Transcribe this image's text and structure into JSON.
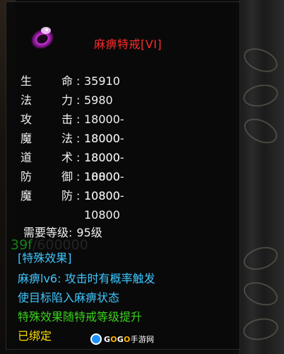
{
  "item": {
    "name": "麻痹特戒[VI]",
    "stats": [
      {
        "k1": "生",
        "k2": "命",
        "value": "35910"
      },
      {
        "k1": "法",
        "k2": "力",
        "value": "5980"
      },
      {
        "k1": "攻",
        "k2": "击",
        "value": "18000-18000"
      },
      {
        "k1": "魔",
        "k2": "法",
        "value": "18000-18000"
      },
      {
        "k1": "道",
        "k2": "术",
        "value": "18000-18000"
      },
      {
        "k1": "防",
        "k2": "御",
        "value": "10800-10800"
      },
      {
        "k1": "魔",
        "k2": "防",
        "value": "10800-10800"
      }
    ],
    "separator": ":",
    "required_level_label": "需要等级:",
    "required_level_value": "95级",
    "progress_current": "39f",
    "progress_slash": "/",
    "progress_total": "600000",
    "effects": {
      "header": "[特殊效果]",
      "line1": "麻痹lv6: 攻击时有概率触发",
      "line2": "使目标陷入麻痹状态",
      "line3": "特殊效果随特戒等级提升"
    },
    "bound_text": "已绑定"
  },
  "watermark": {
    "brand_g1": "G",
    "brand_o1": "O",
    "brand_g2": "G",
    "brand_o2": "O",
    "brand_cn": "手游网"
  },
  "colors": {
    "name_red": "#ff2b2b",
    "effect_cyan": "#3ec7ff",
    "effect_green": "#3ad21c",
    "bound_yellow": "#ffde00"
  }
}
